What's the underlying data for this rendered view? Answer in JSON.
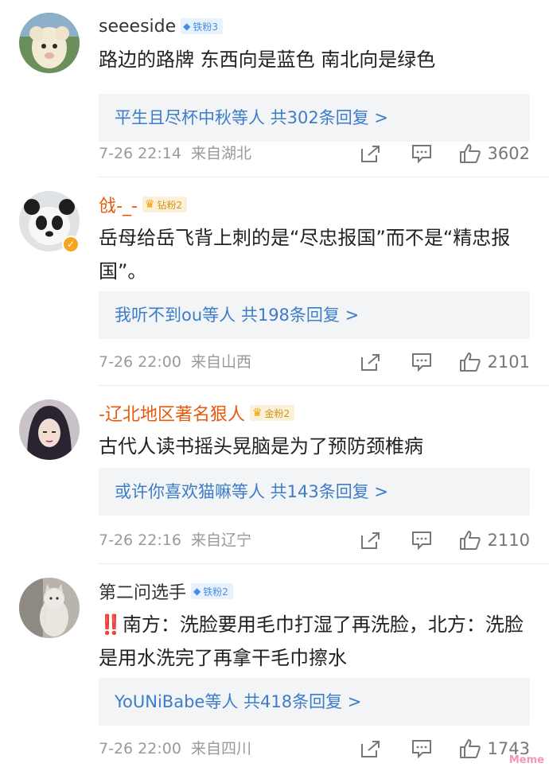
{
  "comments": [
    {
      "username": "seeeside",
      "badge_label": "铁粉3",
      "badge_style": "blue",
      "text": "路边的路牌 东西向是蓝色 南北向是绿色",
      "reply_summary": "平生且尽杯中秋等人  共302条回复 >",
      "time": "7-26 22:14",
      "location": "来自湖北",
      "likes": "3602",
      "avatar_icon": "lamb-avatar"
    },
    {
      "username": "戗-_-",
      "badge_label": "钻粉2",
      "badge_style": "gold",
      "text": "岳母给岳飞背上刺的是“尽忠报国”而不是“精忠报国”。",
      "reply_summary": "我听不到ou等人  共198条回复 >",
      "time": "7-26 22:00",
      "location": "来自山西",
      "likes": "2101",
      "avatar_icon": "panda-avatar"
    },
    {
      "username": "-辽北地区著名狠人",
      "badge_label": "金粉2",
      "badge_style": "gold",
      "text": "古代人读书摇头晃脑是为了预防颈椎病",
      "reply_summary": "或许你喜欢猫嘛等人  共143条回复 >",
      "time": "7-26 22:16",
      "location": "来自辽宁",
      "likes": "2110",
      "avatar_icon": "anime-avatar"
    },
    {
      "username": "第二问选手",
      "badge_label": "铁粉2",
      "badge_style": "blue",
      "text_emoji": "‼️",
      "text": "南方：洗脸要用毛巾打湿了再洗脸，北方：洗脸是用水洗完了再拿干毛巾擦水",
      "reply_summary": "YoUNiBabe等人  共418条回复 >",
      "time": "7-26 22:00",
      "location": "来自四川",
      "likes": "1743",
      "avatar_icon": "cat-avatar"
    }
  ],
  "colors": {
    "link_blue": "#3d7cc9",
    "meta_gray": "#9a9a9a",
    "orange_name": "#e8590c",
    "reply_bg": "#f3f4f6"
  },
  "watermark": "Meme"
}
